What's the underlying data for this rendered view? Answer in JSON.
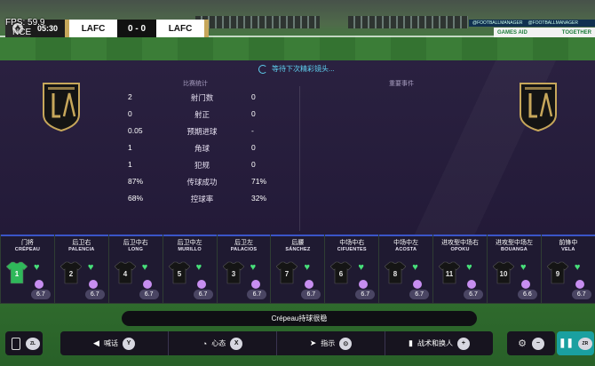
{
  "hud": {
    "fps": "FPS: 59.9",
    "camera": "NCE"
  },
  "scoreboard": {
    "clock": "05:30",
    "home": "LAFC",
    "score": "0 - 0",
    "away": "LAFC"
  },
  "ads": {
    "social1": "@FOOTBALLMANAGER",
    "social2": "@FOOTBALLMANAGER",
    "games_aid": "GAMES AID",
    "together": "TOGETHER"
  },
  "status": {
    "text": "等待下次精彩镜头..."
  },
  "stats": {
    "title": "比赛统计",
    "rows": [
      {
        "home": "2",
        "label": "射门数",
        "away": "0"
      },
      {
        "home": "0",
        "label": "射正",
        "away": "0"
      },
      {
        "home": "0.05",
        "label": "预期进球",
        "away": "-"
      },
      {
        "home": "1",
        "label": "角球",
        "away": "0"
      },
      {
        "home": "1",
        "label": "犯规",
        "away": "0"
      },
      {
        "home": "87%",
        "label": "传球成功",
        "away": "71%"
      },
      {
        "home": "68%",
        "label": "控球率",
        "away": "32%"
      }
    ]
  },
  "events": {
    "title": "重要事件"
  },
  "players": [
    {
      "pos": "门将",
      "name": "CRÉPEAU",
      "number": "1",
      "rating": "6.7",
      "gk": true
    },
    {
      "pos": "后卫右",
      "name": "PALENCIA",
      "number": "2",
      "rating": "6.7"
    },
    {
      "pos": "后卫中右",
      "name": "LONG",
      "number": "4",
      "rating": "6.7"
    },
    {
      "pos": "后卫中左",
      "name": "MURILLO",
      "number": "5",
      "rating": "6.7"
    },
    {
      "pos": "后卫左",
      "name": "PALACIOS",
      "number": "3",
      "rating": "6.7"
    },
    {
      "pos": "后腰",
      "name": "SÁNCHEZ",
      "number": "7",
      "rating": "6.7"
    },
    {
      "pos": "中场中右",
      "name": "CIFUENTES",
      "number": "6",
      "rating": "6.7"
    },
    {
      "pos": "中场中左",
      "name": "ACOSTA",
      "number": "8",
      "rating": "6.7"
    },
    {
      "pos": "进攻型中场右",
      "name": "OPOKU",
      "number": "11",
      "rating": "6.7"
    },
    {
      "pos": "进攻型中场左",
      "name": "BOUANGA",
      "number": "10",
      "rating": "6.6"
    },
    {
      "pos": "前锋中",
      "name": "VELA",
      "number": "9",
      "rating": "6.7"
    }
  ],
  "message": "Crépeau持球很稳",
  "actions": [
    {
      "label": "喊话",
      "key": "Y"
    },
    {
      "label": "心态",
      "key": "X"
    },
    {
      "label": "指示",
      "key": "⊙"
    },
    {
      "label": "战术和换人",
      "key": "+"
    }
  ],
  "bottom_keys": {
    "left": "ZL",
    "settings": "−",
    "right": "ZR"
  },
  "colors": {
    "accent": "#5fd0f0",
    "card_bg": "#1f1a31",
    "heart": "#47e07a",
    "gold": "#c7a75b"
  }
}
